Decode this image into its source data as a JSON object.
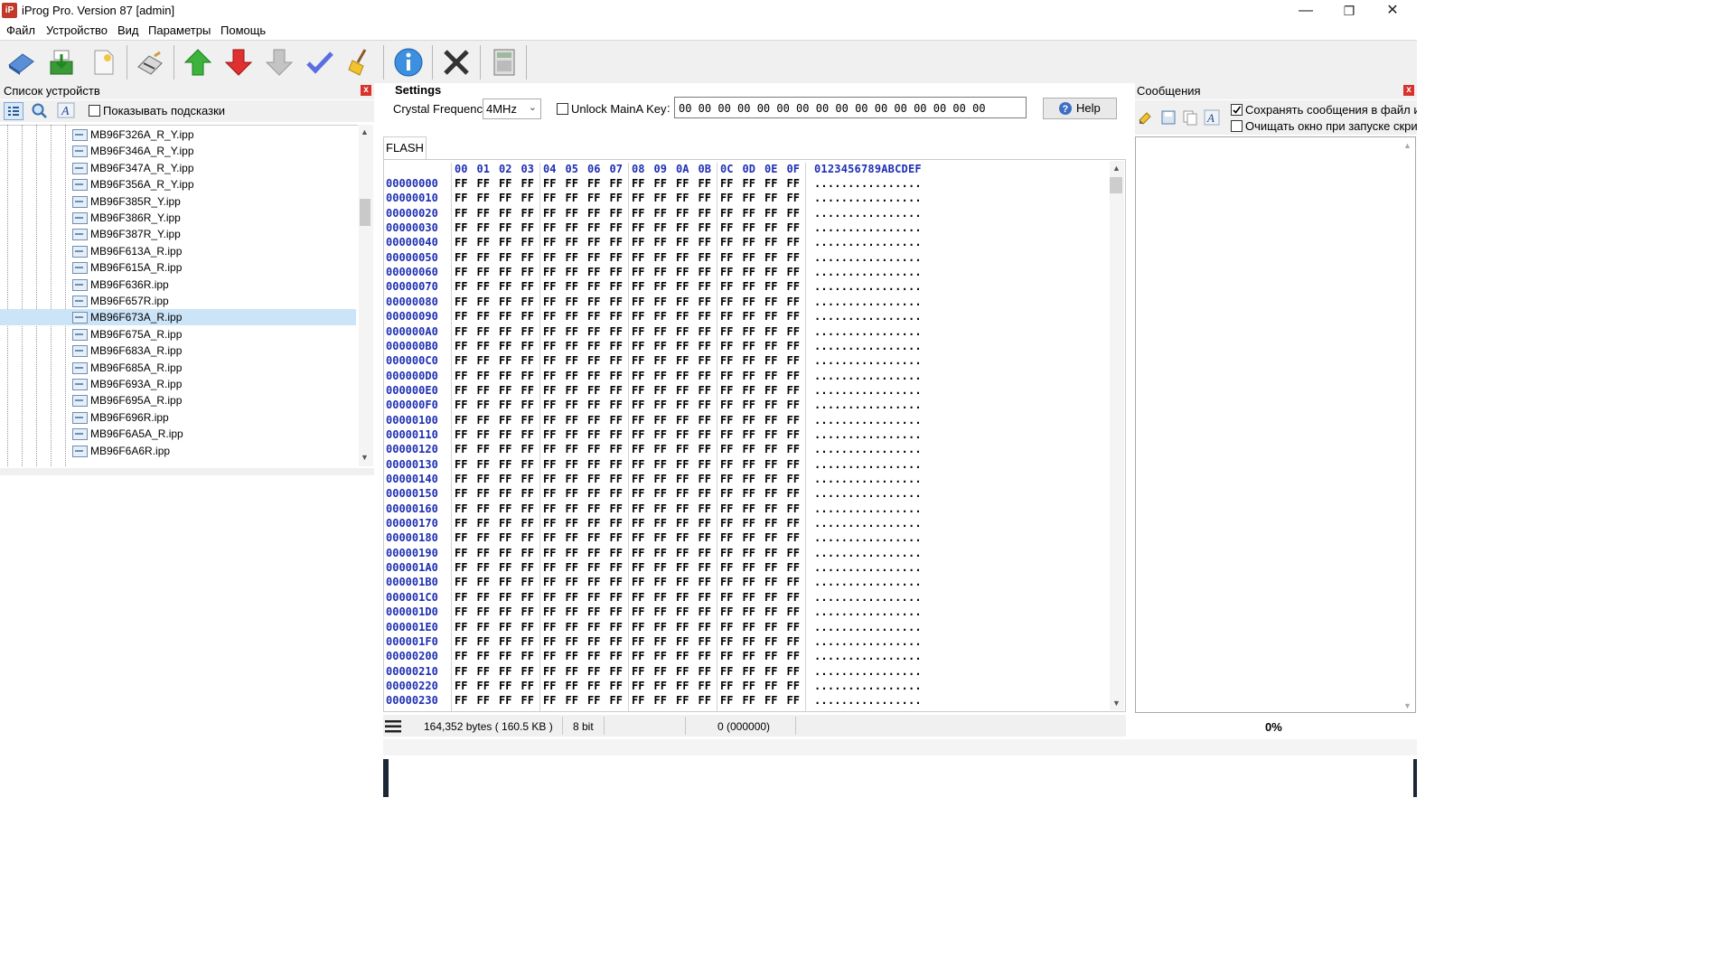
{
  "window": {
    "title": "iProg Pro. Version 87 [admin]",
    "logo_text": "iP",
    "minimize": "—",
    "maximize": "❐",
    "close": "✕"
  },
  "menu": [
    "Файл",
    "Устройство",
    "Вид",
    "Параметры",
    "Помощь"
  ],
  "toolbar_icons": [
    "open-icon",
    "save-icon",
    "new-file-icon",
    "eraser-chip-icon",
    "upload-green-arrow-icon",
    "download-red-arrow-icon",
    "download-grey-arrow-icon",
    "verify-check-icon",
    "clear-broom-icon",
    "info-icon",
    "stop-x-icon",
    "calculator-icon"
  ],
  "device_list": {
    "title": "Список устройств",
    "show_hints": "Показывать подсказки",
    "items": [
      "MB96F326A_R_Y.ipp",
      "MB96F346A_R_Y.ipp",
      "MB96F347A_R_Y.ipp",
      "MB96F356A_R_Y.ipp",
      "MB96F385R_Y.ipp",
      "MB96F386R_Y.ipp",
      "MB96F387R_Y.ipp",
      "MB96F613A_R.ipp",
      "MB96F615A_R.ipp",
      "MB96F636R.ipp",
      "MB96F657R.ipp",
      "MB96F673A_R.ipp",
      "MB96F675A_R.ipp",
      "MB96F683A_R.ipp",
      "MB96F685A_R.ipp",
      "MB96F693A_R.ipp",
      "MB96F695A_R.ipp",
      "MB96F696R.ipp",
      "MB96F6A5A_R.ipp",
      "MB96F6A6R.ipp"
    ],
    "selected_index": 11
  },
  "settings": {
    "title": "Settings",
    "crystal_label": "Crystal Frequency",
    "crystal_value": "4MHz",
    "unlock_label": "Unlock MainA Key",
    "key_value": "00 00 00 00 00 00 00 00 00 00 00 00 00 00 00 00",
    "help_label": "Help"
  },
  "hex_view": {
    "tab": "FLASH",
    "columns": [
      "00",
      "01",
      "02",
      "03",
      "04",
      "05",
      "06",
      "07",
      "08",
      "09",
      "0A",
      "0B",
      "0C",
      "0D",
      "0E",
      "0F"
    ],
    "ascii_header": "0123456789ABCDEF",
    "byte_value": "FF",
    "ascii_row": "................",
    "addresses": [
      "00000000",
      "00000010",
      "00000020",
      "00000030",
      "00000040",
      "00000050",
      "00000060",
      "00000070",
      "00000080",
      "00000090",
      "000000A0",
      "000000B0",
      "000000C0",
      "000000D0",
      "000000E0",
      "000000F0",
      "00000100",
      "00000110",
      "00000120",
      "00000130",
      "00000140",
      "00000150",
      "00000160",
      "00000170",
      "00000180",
      "00000190",
      "000001A0",
      "000001B0",
      "000001C0",
      "000001D0",
      "000001E0",
      "000001F0",
      "00000200",
      "00000210",
      "00000220",
      "00000230"
    ]
  },
  "status": {
    "size": "164,352 bytes ( 160.5 KB )",
    "bits": "8 bit",
    "position": "0 (000000)",
    "progress": "0%"
  },
  "messages": {
    "title": "Сообщения",
    "save_to_file": "Сохранять сообщения в файл ист",
    "clear_on_start": "Очищать окно при запуске скрип",
    "save_checked": true,
    "clear_checked": false
  }
}
